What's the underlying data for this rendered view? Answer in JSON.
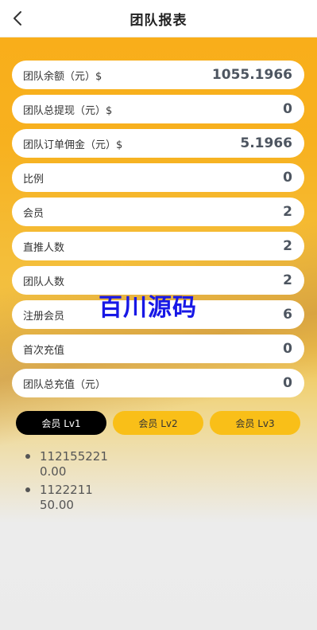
{
  "header": {
    "title": "团队报表",
    "back_icon": "chevron-left-icon"
  },
  "stats": [
    {
      "label": "团队余额（元）$",
      "value": "1055.1966"
    },
    {
      "label": "团队总提现（元）$",
      "value": "0"
    },
    {
      "label": "团队订单佣金（元）$",
      "value": "5.1966"
    },
    {
      "label": "比例",
      "value": "0"
    },
    {
      "label": "会员",
      "value": "2"
    },
    {
      "label": "直推人数",
      "value": "2"
    },
    {
      "label": "团队人数",
      "value": "2"
    },
    {
      "label": "注册会员",
      "value": "6"
    },
    {
      "label": "首次充值",
      "value": "0"
    },
    {
      "label": "团队总充值（元）",
      "value": "0"
    }
  ],
  "watermark": "百川源码",
  "tabs": [
    {
      "label": "会员 Lv1",
      "active": true
    },
    {
      "label": "会员 Lv2",
      "active": false
    },
    {
      "label": "会员 Lv3",
      "active": false
    }
  ],
  "members": [
    {
      "id": "112155221",
      "amount": "0.00"
    },
    {
      "id": "1122211",
      "amount": "50.00"
    }
  ],
  "colors": {
    "accent": "#f9bf18",
    "active_tab": "#000000",
    "watermark": "#1818e6"
  }
}
